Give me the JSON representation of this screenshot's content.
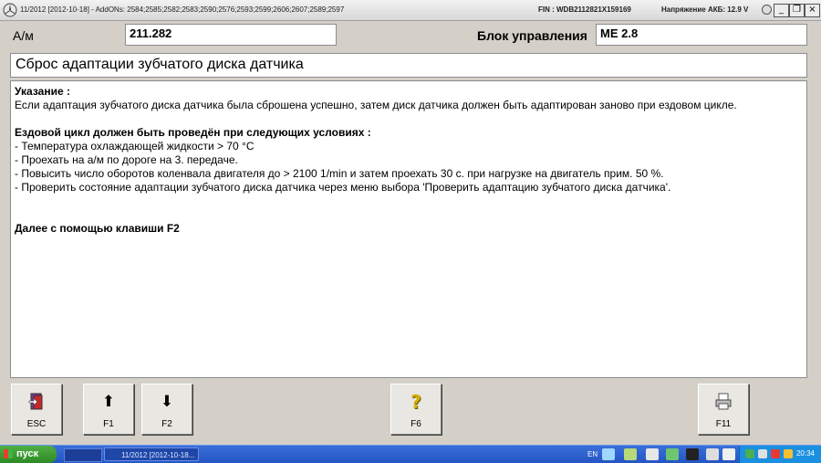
{
  "window": {
    "title": "11/2012 [2012-10-18] - AddONs: 2584;2585;2582;2583;2590;2576;2593;2599;2606;2607;2589;2597",
    "fin": "FIN : WDB2112821X159169",
    "battery_voltage": "Напряжение АКБ: 12.9 V",
    "minimize_label": "_",
    "restore_label": "❐",
    "close_label": "×"
  },
  "vehicle": {
    "label": "А/м",
    "value": "211.282"
  },
  "control_unit": {
    "label": "Блок управления",
    "value": "ME 2.8"
  },
  "page_title": "Сброс адаптации зубчатого диска датчика",
  "content": {
    "note_heading": "Указание :",
    "note_text": "Если адаптация зубчатого диска датчика была сброшена успешно, затем диск датчика должен быть адаптирован заново при ездовом цикле.",
    "cycle_heading": "Ездовой цикл должен быть проведён при следующих условиях :",
    "conditions": [
      "- Температура охлаждающей жидкости > 70 °C",
      "- Проехать на а/м по дороге на 3. передаче.",
      "- Повысить число оборотов коленвала двигателя до > 2100 1/min и затем проехать 30 с. при нагрузке на двигатель прим. 50 %.",
      "- Проверить состояние адаптации зубчатого диска датчика через меню выбора 'Проверить адаптацию зубчатого диска датчика'."
    ],
    "continue_text": "Далее с помощью клавиши F2"
  },
  "function_keys": [
    {
      "label": "ESC",
      "icon": "exit-door-icon",
      "glyph": "⇦",
      "color": "#8a2a7a"
    },
    {
      "label": "F1",
      "icon": "arrow-up-icon",
      "glyph": "⬆",
      "color": "#000000"
    },
    {
      "label": "F2",
      "icon": "arrow-down-icon",
      "glyph": "⬇",
      "color": "#000000"
    },
    {
      "label": "F6",
      "icon": "help-question-icon",
      "glyph": "?",
      "color": "#d4b000"
    },
    {
      "label": "F11",
      "icon": "printer-icon",
      "glyph": "⎙",
      "color": "#555555"
    }
  ],
  "taskbar": {
    "start_label": "пуск",
    "task_label": "11/2012 [2012-10-18...",
    "language": "EN",
    "clock": "20:34"
  }
}
